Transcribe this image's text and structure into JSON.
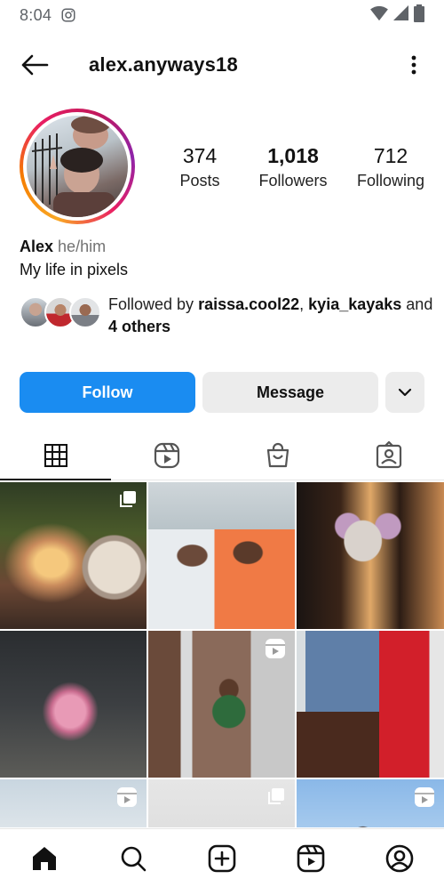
{
  "status_bar": {
    "time": "8:04"
  },
  "header": {
    "username": "alex.anyways18"
  },
  "profile": {
    "stats": [
      {
        "value": "374",
        "label": "Posts"
      },
      {
        "value": "1,018",
        "label": "Followers"
      },
      {
        "value": "712",
        "label": "Following"
      }
    ],
    "name": "Alex",
    "pronouns": "he/him",
    "bio": "My life in pixels",
    "followed_by": {
      "prefix": "Followed by",
      "user1": "raissa.cool22",
      "separator": ",",
      "user2": "kyia_kayaks",
      "and": "and",
      "others": "4 others"
    }
  },
  "actions": {
    "follow_label": "Follow",
    "message_label": "Message"
  },
  "tabs": [
    "grid-icon",
    "reels-icon",
    "shop-icon",
    "tagged-icon"
  ],
  "nav": [
    "home-icon",
    "search-icon",
    "create-icon",
    "reels-icon",
    "profile-icon"
  ],
  "colors": {
    "follow_blue": "#1a8cf1",
    "secondary_button": "#ececec"
  }
}
